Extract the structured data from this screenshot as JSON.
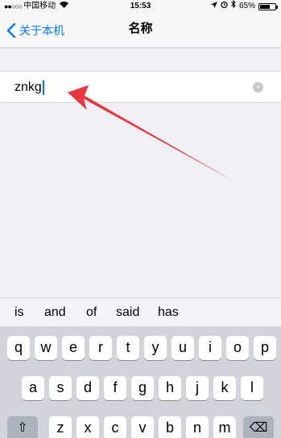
{
  "status_bar": {
    "signal": "●●○○○",
    "carrier": "中国移动",
    "time": "15:53",
    "battery_percent": "65%",
    "battery_level": 0.65,
    "icons": [
      "wifi-icon",
      "location-icon",
      "alarm-icon",
      "bluetooth-icon",
      "battery-icon"
    ]
  },
  "nav": {
    "back_label": "关于本机",
    "title": "名称"
  },
  "field": {
    "value": "znkg",
    "clear_icon": "×"
  },
  "suggestions": [
    "is",
    "and",
    "of",
    "said",
    "has"
  ],
  "keyboard": {
    "row1": [
      "q",
      "w",
      "e",
      "r",
      "t",
      "y",
      "u",
      "i",
      "o",
      "p"
    ],
    "row2": [
      "a",
      "s",
      "d",
      "f",
      "g",
      "h",
      "j",
      "k",
      "l"
    ],
    "row3": [
      "z",
      "x",
      "c",
      "v",
      "b",
      "n",
      "m"
    ],
    "shift_icon": "⇧",
    "delete_icon": "⌫"
  },
  "annotation": {
    "color": "#e8383d"
  }
}
